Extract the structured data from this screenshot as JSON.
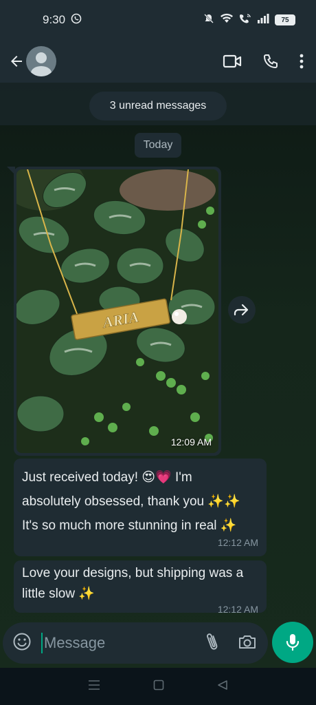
{
  "status_bar": {
    "time": "9:30",
    "battery": "75"
  },
  "header": {
    "contact_name": ""
  },
  "chat": {
    "unread_label": "3 unread messages",
    "date_label": "Today",
    "image_message": {
      "engraving": "ARIA",
      "time": "12:09 AM"
    },
    "messages": [
      {
        "text_lines": [
          "Just received today! 😍💗 I'm",
          "absolutely obsessed, thank you ✨✨",
          "It's so much more stunning in real ✨"
        ],
        "time": "12:12 AM"
      },
      {
        "text_lines": [
          "Love your designs, but shipping was a",
          "little slow ✨"
        ],
        "time": "12:12 AM"
      }
    ]
  },
  "input": {
    "placeholder": "Message"
  },
  "icons": {
    "status": [
      "whatsapp-icon",
      "mute-icon",
      "wifi-icon",
      "wifi-call-icon",
      "signal-icon",
      "battery-icon"
    ],
    "header": [
      "back-arrow-icon",
      "avatar-icon",
      "video-call-icon",
      "voice-call-icon",
      "more-vert-icon"
    ],
    "input": [
      "emoji-icon",
      "attach-icon",
      "camera-icon",
      "mic-icon"
    ],
    "nav": [
      "recents-icon",
      "home-icon",
      "back-icon"
    ]
  },
  "colors": {
    "accent": "#00a884",
    "bubble": "#1f2c33",
    "header": "#1f2c33",
    "meta_text": "#8696a0"
  }
}
